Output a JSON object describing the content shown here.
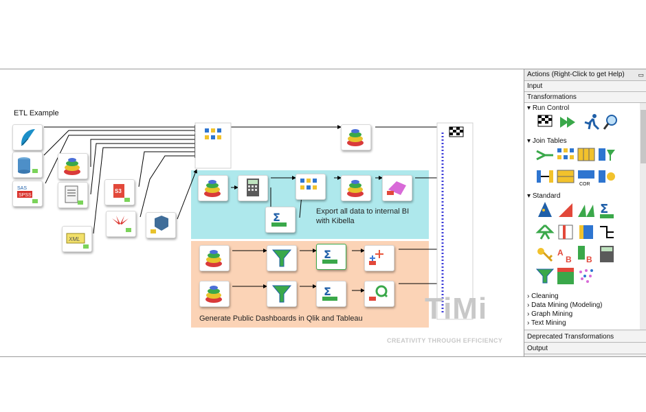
{
  "canvas": {
    "title": "ETL Example",
    "zone_bi_label": "Export all data to internal BI with Kibella",
    "zone_dash_label": "Generate Public Dashboards in Qlik and Tableau",
    "watermark_logo": "TiMi",
    "watermark_slogan": "CREATIVITY THROUGH EFFICIENCY",
    "node_labels": {
      "sas": "SAS",
      "spss": "SPSS",
      "s3": "S3",
      "xml": "XML",
      "cor": "COR"
    },
    "colors": {
      "zone_bi": "#aee8ec",
      "zone_dash": "#fbd3b6",
      "link": "#000000",
      "port": "#3b3bd8"
    }
  },
  "panel": {
    "header": "Actions (Right-Click to get Help)",
    "sections_top": [
      "Input",
      "Transformations"
    ],
    "groups": [
      "Run Control",
      "Join Tables",
      "Standard"
    ],
    "subgroups": [
      "Cleaning",
      "Data Mining (Modeling)",
      "Graph Mining",
      "Text Mining"
    ],
    "sections_bottom": [
      "Deprecated Transformations",
      "Output"
    ]
  }
}
